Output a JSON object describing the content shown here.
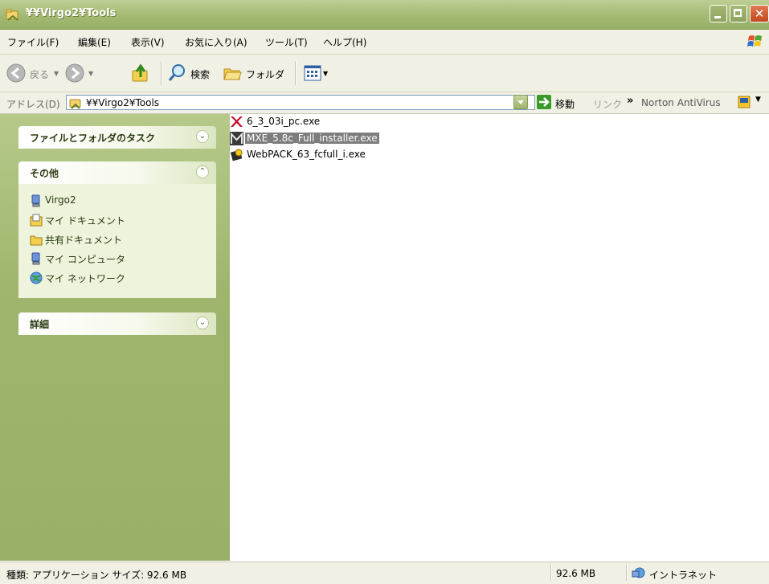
{
  "window": {
    "title": "¥¥Virgo2¥Tools"
  },
  "menu": {
    "items": [
      "ファイル(F)",
      "編集(E)",
      "表示(V)",
      "お気に入り(A)",
      "ツール(T)",
      "ヘルプ(H)"
    ]
  },
  "toolbar": {
    "back": "戻る",
    "search": "検索",
    "folders": "フォルダ"
  },
  "address": {
    "label": "アドレス(D)",
    "value": "¥¥Virgo2¥Tools",
    "go": "移動",
    "links": "リンク",
    "norton": "Norton AntiVirus"
  },
  "tasks": {
    "file_folder_tasks": "ファイルとフォルダのタスク",
    "other": {
      "title": "その他",
      "items": [
        "Virgo2",
        "マイ ドキュメント",
        "共有ドキュメント",
        "マイ コンピュータ",
        "マイ ネットワーク"
      ]
    },
    "details": "詳細"
  },
  "files": [
    {
      "name": "6_3_03i_pc.exe",
      "selected": false
    },
    {
      "name": "MXE_5.8c_Full_installer.exe",
      "selected": true
    },
    {
      "name": "WebPACK_63_fcfull_i.exe",
      "selected": false
    }
  ],
  "status": {
    "text": "種類: アプリケーション サイズ: 92.6 MB",
    "size": "92.6 MB",
    "zone": "イントラネット"
  }
}
